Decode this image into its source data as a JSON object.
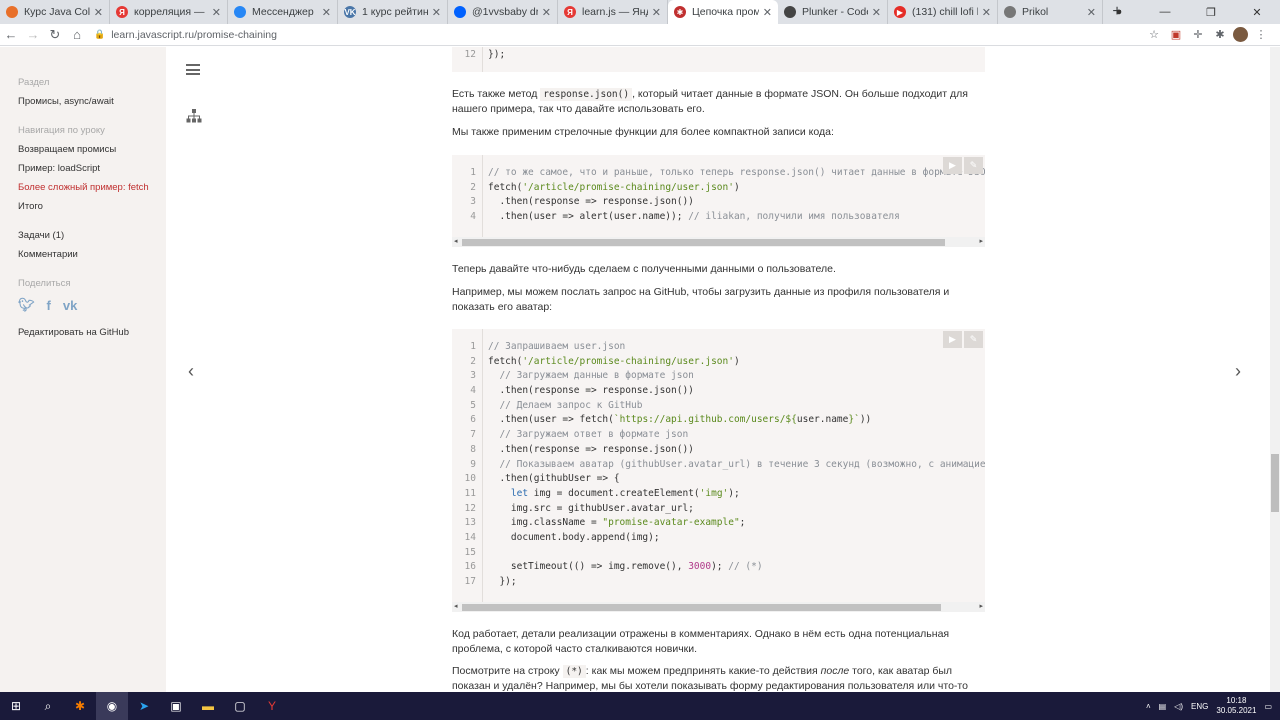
{
  "browser": {
    "tabs": [
      {
        "title": "Курс Java Collectio",
        "fav_color": "#e8702a",
        "fav_char": ""
      },
      {
        "title": "корреляция — Янде",
        "fav_color": "#e53935",
        "fav_char": "Я"
      },
      {
        "title": "Мессенджер",
        "fav_color": "#2787f5",
        "fav_char": ""
      },
      {
        "title": "1 курс рейтинг.do",
        "fav_color": "#4a76a8",
        "fav_char": "VK"
      },
      {
        "title": "@1vvsbaby drum k",
        "fav_color": "#0061fe",
        "fav_char": ""
      },
      {
        "title": "learn.js — Яндекс",
        "fav_color": "#e53935",
        "fav_char": "Я"
      },
      {
        "title": "Цепочка промисо",
        "fav_color": "#c03030",
        "fav_char": "✱"
      },
      {
        "title": "Plunker - Code exa",
        "fav_color": "#444444",
        "fav_char": ""
      },
      {
        "title": "(131) chill lofi beats",
        "fav_color": "#e52d27",
        "fav_char": "▶"
      },
      {
        "title": "Prikol",
        "fav_color": "#777777",
        "fav_char": ""
      }
    ],
    "active_tab": 6,
    "url": "learn.javascript.ru/promise-chaining"
  },
  "sidebar": {
    "section_label": "Раздел",
    "section_link": "Промисы, async/await",
    "nav_label": "Навигация по уроку",
    "nav_items": [
      {
        "label": "Возвращаем промисы",
        "current": false
      },
      {
        "label": "Пример: loadScript",
        "current": false
      },
      {
        "label": "Более сложный пример: fetch",
        "current": true
      },
      {
        "label": "Итого",
        "current": false
      }
    ],
    "tasks": "Задачи (1)",
    "comments": "Комментарии",
    "share_label": "Поделиться",
    "social": [
      "twitter-icon",
      "facebook-icon",
      "vk-icon"
    ],
    "edit_github": "Редактировать на GitHub"
  },
  "content": {
    "prev_block_line": "12",
    "prev_block_code": "});",
    "para1_before": "Есть также метод ",
    "para1_code": "response.json()",
    "para1_after": ", который читает данные в формате JSON. Он больше подходит для нашего примера, так что давайте использовать его.",
    "para2": "Мы также применим стрелочные функции для более компактной записи кода:",
    "para3": "Теперь давайте что-нибудь сделаем с полученными данными о пользователе.",
    "para4": "Например, мы можем послать запрос на GitHub, чтобы загрузить данные из профиля пользователя и показать его аватар:",
    "para5": "Код работает, детали реализации отражены в комментариях. Однако в нём есть одна потенциальная проблема, с которой часто сталкиваются новички.",
    "para6_before": "Посмотрите на строку ",
    "para6_code": "(*)",
    "para6_mid": ": как мы можем предпринять какие-то действия ",
    "para6_em": "после",
    "para6_after": " того, как аватар был показан и удалён? Например, мы бы хотели показывать форму редактирования пользователя или что-то"
  },
  "taskbar": {
    "lang": "ENG",
    "time": "10:18",
    "date": "30.05.2021"
  }
}
